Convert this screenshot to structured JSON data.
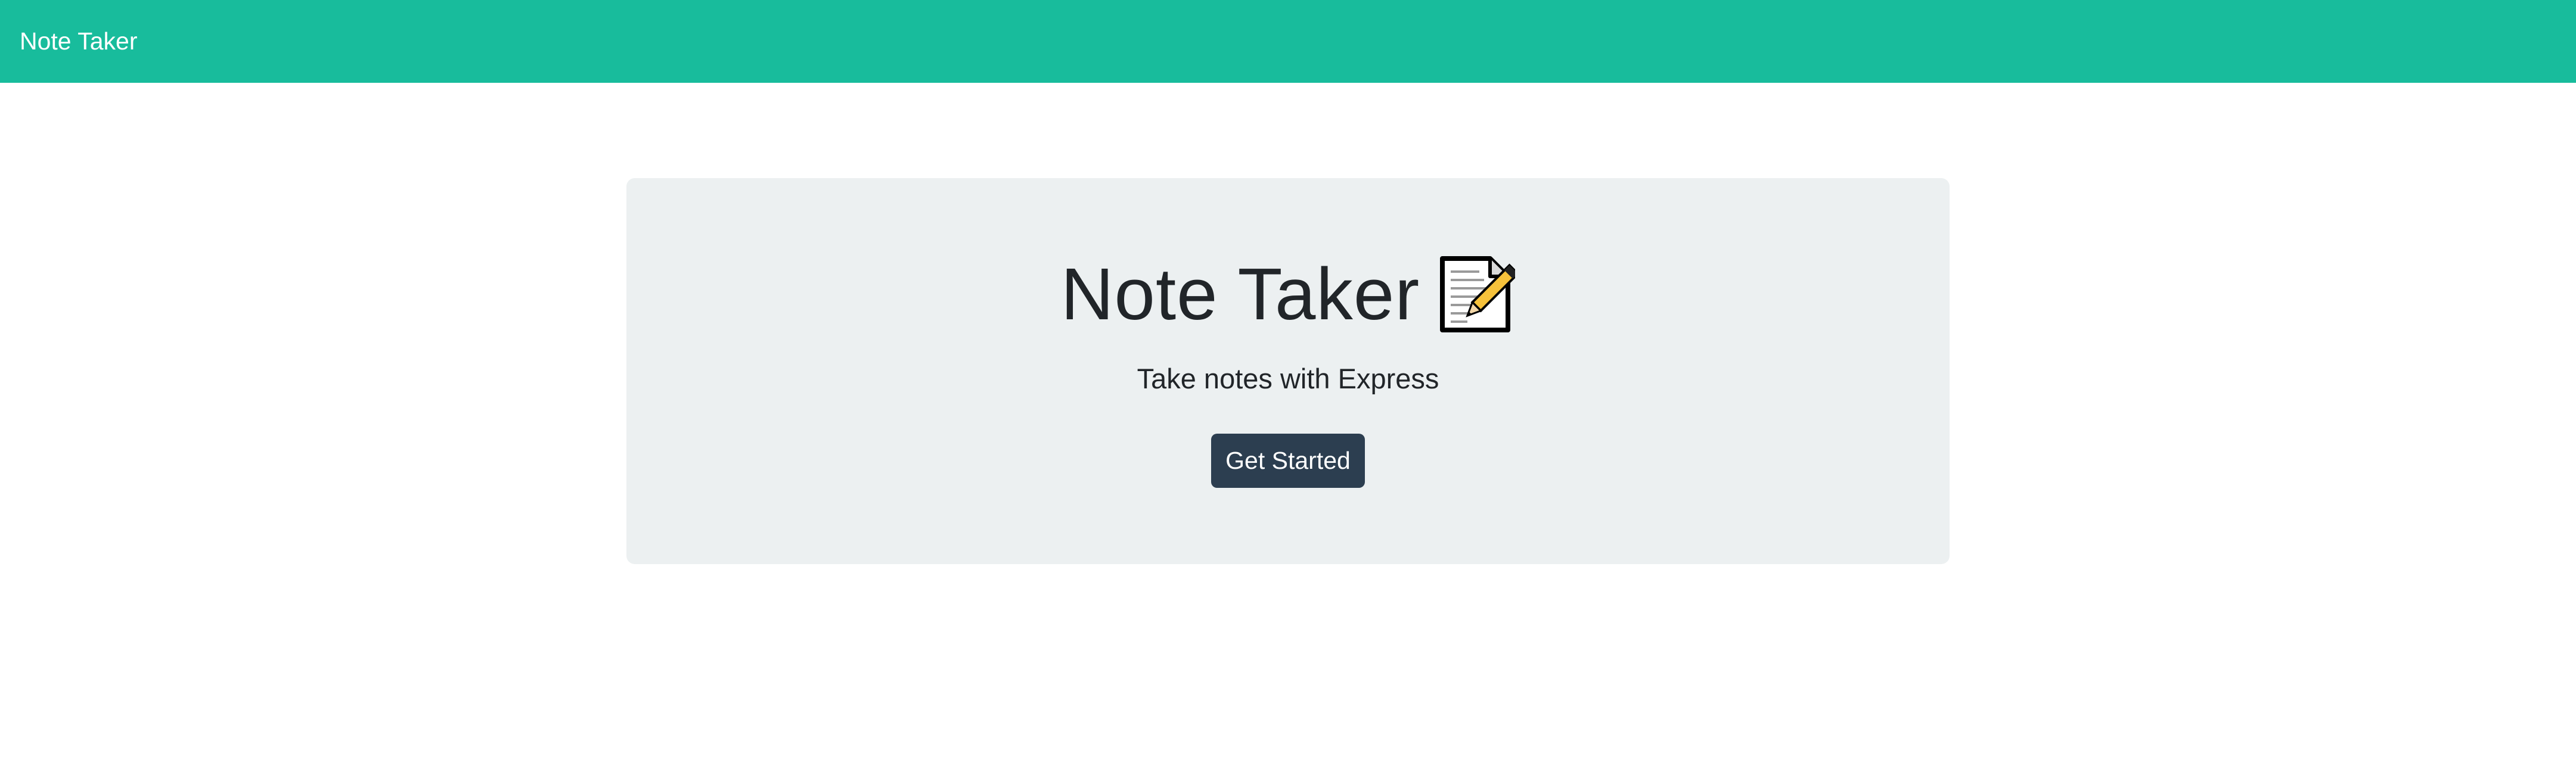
{
  "navbar": {
    "brand": "Note Taker",
    "background_color": "#18bc9c"
  },
  "hero": {
    "title": "Note Taker",
    "title_icon": "memo-icon",
    "subtitle": "Take notes with Express",
    "button_label": "Get Started",
    "button_color": "#2c3e50",
    "background_color": "#ecf0f1"
  }
}
